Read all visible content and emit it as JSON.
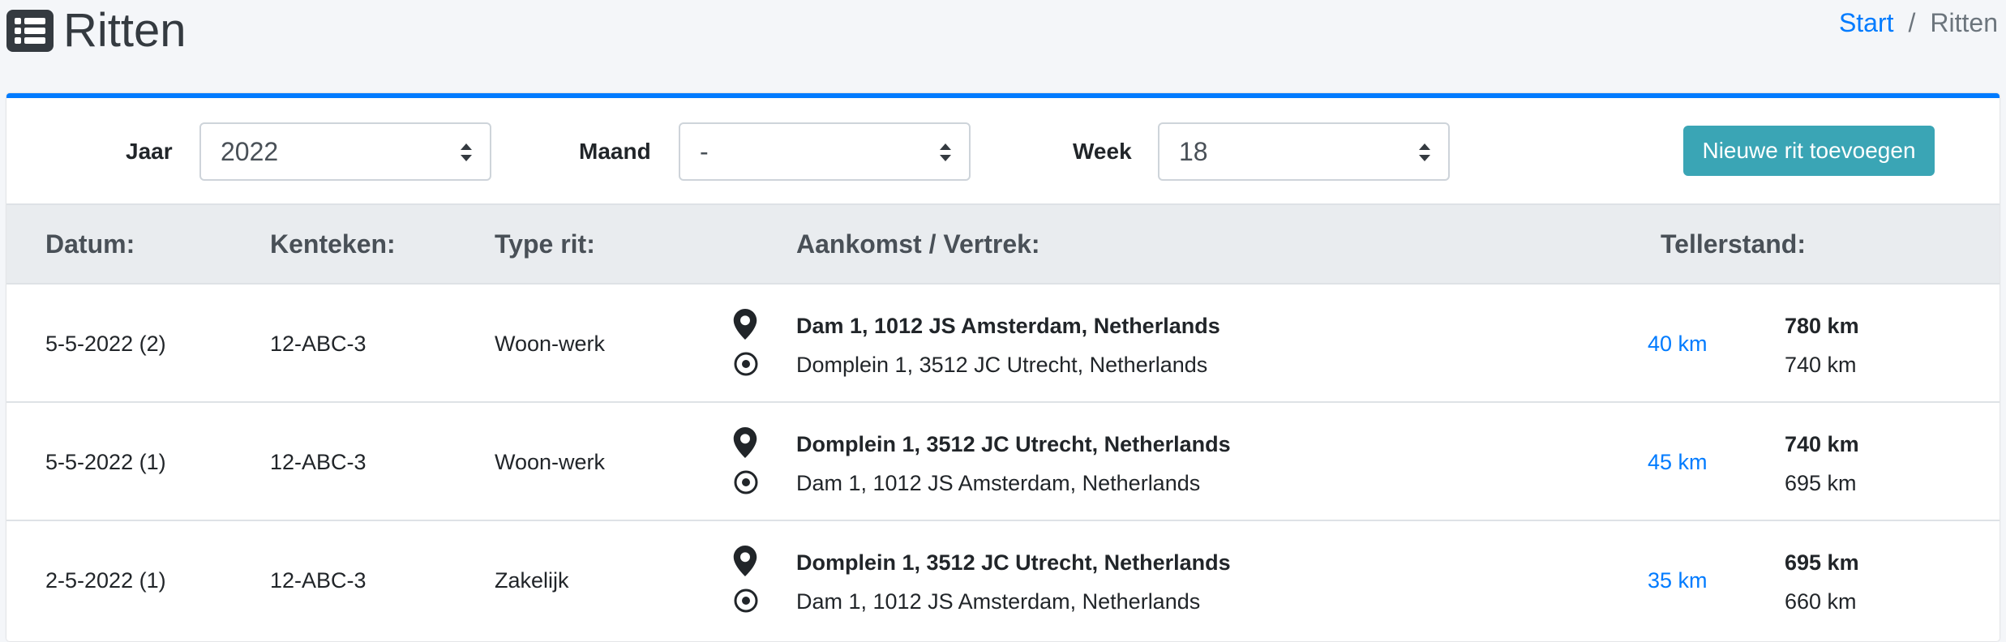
{
  "header": {
    "icon": "list-icon",
    "title": "Ritten",
    "breadcrumb": [
      {
        "label": "Start"
      },
      {
        "label": "Ritten"
      }
    ],
    "separator": "/"
  },
  "filters": {
    "year_label": "Jaar",
    "year_value": "2022",
    "month_label": "Maand",
    "month_value": "-",
    "week_label": "Week",
    "week_value": "18",
    "new_button": "Nieuwe rit toevoegen"
  },
  "table": {
    "columns": [
      "Datum:",
      "Kenteken:",
      "Type rit:",
      "Aankomst / Vertrek:",
      "Tellerstand:"
    ],
    "rows": [
      {
        "date": "5-5-2022 (2)",
        "plate": "12-ABC-3",
        "type": "Woon-werk",
        "arrival": "Dam 1, 1012 JS Amsterdam, Netherlands",
        "departure": "Domplein 1, 3512 JC Utrecht, Netherlands",
        "distance": "40 km",
        "odo_end": "780 km",
        "odo_start": "740 km"
      },
      {
        "date": "5-5-2022 (1)",
        "plate": "12-ABC-3",
        "type": "Woon-werk",
        "arrival": "Domplein 1, 3512 JC Utrecht, Netherlands",
        "departure": "Dam 1, 1012 JS Amsterdam, Netherlands",
        "distance": "45 km",
        "odo_end": "740 km",
        "odo_start": "695 km"
      },
      {
        "date": "2-5-2022 (1)",
        "plate": "12-ABC-3",
        "type": "Zakelijk",
        "arrival": "Domplein 1, 3512 JC Utrecht, Netherlands",
        "departure": "Dam 1, 1012 JS Amsterdam, Netherlands",
        "distance": "35 km",
        "odo_end": "695 km",
        "odo_start": "660 km"
      }
    ]
  },
  "colors": {
    "accent": "#007bff",
    "button": "#3aa5b5",
    "header_bg": "#e9ecef"
  },
  "icons": {
    "arrival": "map-marker-icon",
    "departure": "target-icon",
    "select": "sort-arrows-icon"
  }
}
